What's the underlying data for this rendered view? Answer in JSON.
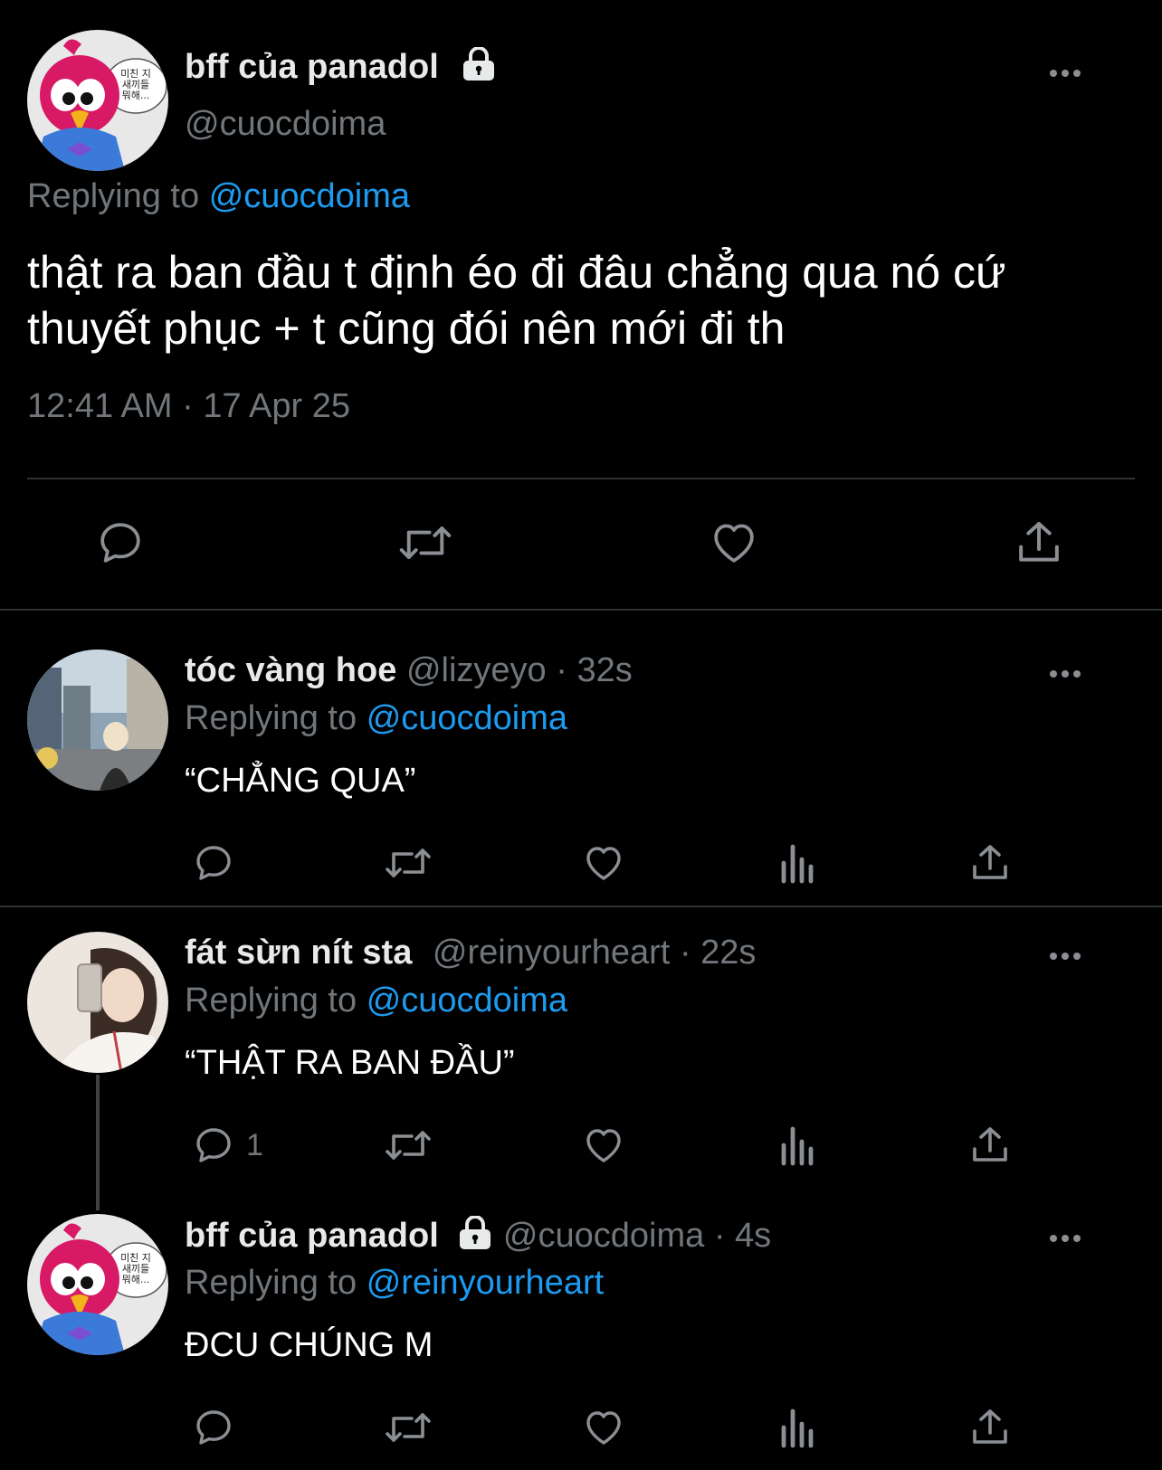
{
  "main_tweet": {
    "display_name": "bff của panadol",
    "handle": "@cuocdoima",
    "replying_prefix": "Replying to",
    "replying_handle": "@cuocdoima",
    "text_line1": "thật ra ban đầu t định éo đi đâu chẳng qua nó cứ",
    "text_line2": "thuyết phục + t cũng đói nên mới đi th",
    "timestamp": "12:41 AM · 17 Apr 25",
    "avatar_speech": [
      "미친 지",
      "새끼들",
      "뭐해..."
    ]
  },
  "replies": [
    {
      "display_name": "tóc vàng hoe",
      "handle": "@lizyeyo",
      "time": "· 32s",
      "replying_prefix": "Replying to",
      "replying_handle": "@cuocdoima",
      "text": "“CHẲNG QUA”",
      "reply_count": ""
    },
    {
      "display_name": "fát sừn nít sta",
      "handle": "@reinyourheart",
      "time": "· 22s",
      "replying_prefix": "Replying to",
      "replying_handle": "@cuocdoima",
      "text": "“THẬT RA BAN ĐẦU”",
      "reply_count": "1"
    },
    {
      "display_name": "bff của panadol",
      "handle": "@cuocdoima",
      "time": "· 4s",
      "replying_prefix": "Replying to",
      "replying_handle": "@reinyourheart",
      "text": "ĐCU CHÚNG M",
      "reply_count": "",
      "avatar_speech": [
        "미친 지",
        "새끼들",
        "뭐해..."
      ]
    }
  ],
  "colors": {
    "background": "#000000",
    "text": "#e7e9ea",
    "secondary": "#71767b",
    "link": "#1d9bf0",
    "divider": "#2f3336"
  },
  "icons": [
    "reply-icon",
    "retweet-icon",
    "like-icon",
    "views-icon",
    "share-icon",
    "lock-icon",
    "more-icon"
  ]
}
